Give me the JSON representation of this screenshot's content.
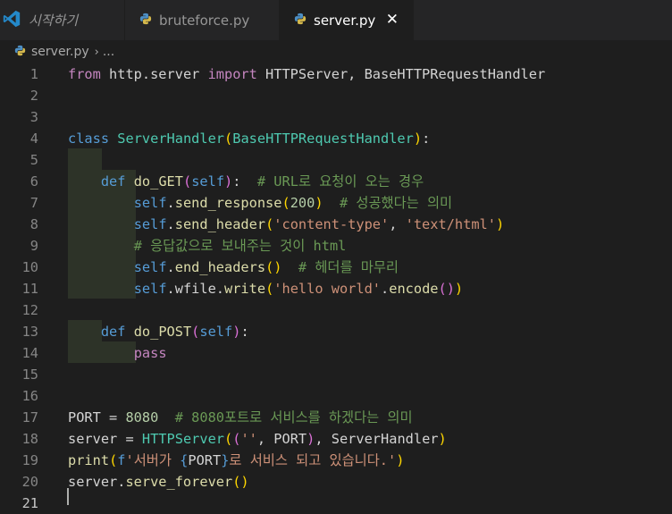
{
  "tabs": [
    {
      "label": "시작하기",
      "icon": "vscode-icon",
      "active": false
    },
    {
      "label": "bruteforce.py",
      "icon": "python-icon",
      "active": false
    },
    {
      "label": "server.py",
      "icon": "python-icon",
      "active": true
    }
  ],
  "close_glyph": "✕",
  "breadcrumb": {
    "file": "server.py",
    "separator": "›",
    "rest": "..."
  },
  "colors": {
    "keyword": "#569cd6",
    "import": "#c586c0",
    "class": "#4ec9b0",
    "function": "#dcdcaa",
    "string": "#ce9178",
    "number": "#b5cea8",
    "comment": "#6a9955",
    "text": "#d4d4d4"
  },
  "code_lines": [
    {
      "n": "1",
      "tokens": [
        [
          "imp",
          "from"
        ],
        [
          "plain",
          " http.server "
        ],
        [
          "imp",
          "import"
        ],
        [
          "plain",
          " HTTPServer, BaseHTTPRequestHandler"
        ]
      ]
    },
    {
      "n": "2",
      "tokens": []
    },
    {
      "n": "3",
      "tokens": []
    },
    {
      "n": "4",
      "tokens": [
        [
          "kw",
          "class"
        ],
        [
          "plain",
          " "
        ],
        [
          "cls",
          "ServerHandler"
        ],
        [
          "br1",
          "("
        ],
        [
          "cls",
          "BaseHTTPRequestHandler"
        ],
        [
          "br1",
          ")"
        ],
        [
          "plain",
          ":"
        ]
      ]
    },
    {
      "n": "5",
      "tokens": []
    },
    {
      "n": "6",
      "tokens": [
        [
          "plain",
          "    "
        ],
        [
          "kw",
          "def"
        ],
        [
          "plain",
          " "
        ],
        [
          "fn",
          "do_GET"
        ],
        [
          "br2",
          "("
        ],
        [
          "self",
          "self"
        ],
        [
          "br2",
          ")"
        ],
        [
          "plain",
          ":  "
        ],
        [
          "com",
          "# URL로 요청이 오는 경우"
        ]
      ]
    },
    {
      "n": "7",
      "tokens": [
        [
          "plain",
          "        "
        ],
        [
          "self",
          "self"
        ],
        [
          "plain",
          "."
        ],
        [
          "fn",
          "send_response"
        ],
        [
          "br1",
          "("
        ],
        [
          "num",
          "200"
        ],
        [
          "br1",
          ")"
        ],
        [
          "plain",
          "  "
        ],
        [
          "com",
          "# 성공했다는 의미"
        ]
      ]
    },
    {
      "n": "8",
      "tokens": [
        [
          "plain",
          "        "
        ],
        [
          "self",
          "self"
        ],
        [
          "plain",
          "."
        ],
        [
          "fn",
          "send_header"
        ],
        [
          "br1",
          "("
        ],
        [
          "str",
          "'content-type'"
        ],
        [
          "plain",
          ", "
        ],
        [
          "str",
          "'text/html'"
        ],
        [
          "br1",
          ")"
        ]
      ]
    },
    {
      "n": "9",
      "tokens": [
        [
          "plain",
          "        "
        ],
        [
          "com",
          "# 응답값으로 보내주는 것이 html"
        ]
      ]
    },
    {
      "n": "10",
      "tokens": [
        [
          "plain",
          "        "
        ],
        [
          "self",
          "self"
        ],
        [
          "plain",
          "."
        ],
        [
          "fn",
          "end_headers"
        ],
        [
          "br1",
          "()"
        ],
        [
          "plain",
          "  "
        ],
        [
          "com",
          "# 헤더를 마무리"
        ]
      ]
    },
    {
      "n": "11",
      "tokens": [
        [
          "plain",
          "        "
        ],
        [
          "self",
          "self"
        ],
        [
          "plain",
          ".wfile."
        ],
        [
          "fn",
          "write"
        ],
        [
          "br1",
          "("
        ],
        [
          "str",
          "'hello world'"
        ],
        [
          "plain",
          "."
        ],
        [
          "fn",
          "encode"
        ],
        [
          "br2",
          "()"
        ],
        [
          "br1",
          ")"
        ]
      ]
    },
    {
      "n": "12",
      "tokens": []
    },
    {
      "n": "13",
      "tokens": [
        [
          "plain",
          "    "
        ],
        [
          "kw",
          "def"
        ],
        [
          "plain",
          " "
        ],
        [
          "fn",
          "do_POST"
        ],
        [
          "br2",
          "("
        ],
        [
          "self",
          "self"
        ],
        [
          "br2",
          ")"
        ],
        [
          "plain",
          ":"
        ]
      ]
    },
    {
      "n": "14",
      "tokens": [
        [
          "plain",
          "        "
        ],
        [
          "imp",
          "pass"
        ]
      ]
    },
    {
      "n": "15",
      "tokens": []
    },
    {
      "n": "16",
      "tokens": []
    },
    {
      "n": "17",
      "tokens": [
        [
          "plain",
          "PORT = "
        ],
        [
          "num",
          "8080"
        ],
        [
          "plain",
          "  "
        ],
        [
          "com",
          "# 8080포트로 서비스를 하겠다는 의미"
        ]
      ]
    },
    {
      "n": "18",
      "tokens": [
        [
          "plain",
          "server = "
        ],
        [
          "cls",
          "HTTPServer"
        ],
        [
          "br1",
          "("
        ],
        [
          "br2",
          "("
        ],
        [
          "str",
          "''"
        ],
        [
          "plain",
          ", PORT"
        ],
        [
          "br2",
          ")"
        ],
        [
          "plain",
          ", ServerHandler"
        ],
        [
          "br1",
          ")"
        ]
      ]
    },
    {
      "n": "19",
      "tokens": [
        [
          "fn",
          "print"
        ],
        [
          "br1",
          "("
        ],
        [
          "kw",
          "f"
        ],
        [
          "str",
          "'서버가 "
        ],
        [
          "kw",
          "{"
        ],
        [
          "plain",
          "PORT"
        ],
        [
          "kw",
          "}"
        ],
        [
          "str",
          "로 서비스 되고 있습니다.'"
        ],
        [
          "br1",
          ")"
        ]
      ]
    },
    {
      "n": "20",
      "tokens": [
        [
          "plain",
          "server."
        ],
        [
          "fn",
          "serve_forever"
        ],
        [
          "br1",
          "()"
        ]
      ]
    },
    {
      "n": "21",
      "tokens": []
    }
  ]
}
